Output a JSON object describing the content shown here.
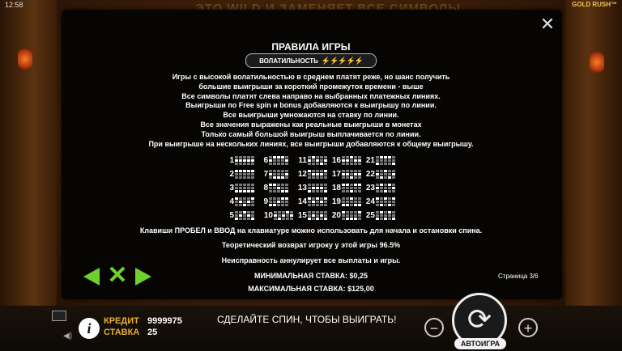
{
  "status": {
    "time": "12:58",
    "logo": "GOLD RUSH™"
  },
  "banner": "ЭТО WILD И ЗАМЕНЯЕТ ВСЕ СИМВОЛЫ",
  "rules_panel": {
    "title": "ПРАВИЛА ИГРЫ",
    "volatility_label": "ВОЛАТИЛЬНОСТЬ",
    "volatility_bolts": "⚡⚡⚡⚡⚡",
    "volatility_level": 5,
    "paragraphs": [
      "Игры с высокой волатильностью в среднем платят реже, но шанс получить",
      "большие выигрыши за короткий промежуток времени - выше",
      "Все символы платят слева направо на выбранных платежных линиях.",
      "Выигрыши по Free spin и bonus добавляются к выигрышу по линии.",
      "Все выигрыши умножаются на ставку по линии.",
      "Все значения выражены как реальные выигрыши в монетах",
      "Только самый большой выигрыш выплачивается по линии.",
      "При выигрыше на нескольких линиях, все выигрыши добавляются к общему выигрышу."
    ],
    "paylines": [
      {
        "n": "1",
        "p": [
          1,
          1,
          1,
          1,
          1
        ]
      },
      {
        "n": "2",
        "p": [
          0,
          0,
          0,
          0,
          0
        ]
      },
      {
        "n": "3",
        "p": [
          2,
          2,
          2,
          2,
          2
        ]
      },
      {
        "n": "4",
        "p": [
          0,
          1,
          2,
          1,
          0
        ]
      },
      {
        "n": "5",
        "p": [
          2,
          1,
          0,
          1,
          2
        ]
      },
      {
        "n": "6",
        "p": [
          1,
          0,
          0,
          0,
          1
        ]
      },
      {
        "n": "7",
        "p": [
          1,
          2,
          2,
          2,
          1
        ]
      },
      {
        "n": "8",
        "p": [
          0,
          0,
          1,
          2,
          2
        ]
      },
      {
        "n": "9",
        "p": [
          2,
          2,
          1,
          0,
          0
        ]
      },
      {
        "n": "10",
        "p": [
          1,
          2,
          1,
          0,
          1
        ]
      },
      {
        "n": "11",
        "p": [
          1,
          0,
          1,
          2,
          1
        ]
      },
      {
        "n": "12",
        "p": [
          0,
          1,
          1,
          1,
          0
        ]
      },
      {
        "n": "13",
        "p": [
          2,
          1,
          1,
          1,
          2
        ]
      },
      {
        "n": "14",
        "p": [
          0,
          1,
          0,
          1,
          0
        ]
      },
      {
        "n": "15",
        "p": [
          2,
          1,
          2,
          1,
          2
        ]
      },
      {
        "n": "16",
        "p": [
          1,
          1,
          0,
          1,
          1
        ]
      },
      {
        "n": "17",
        "p": [
          1,
          1,
          2,
          1,
          1
        ]
      },
      {
        "n": "18",
        "p": [
          0,
          0,
          2,
          0,
          0
        ]
      },
      {
        "n": "19",
        "p": [
          2,
          2,
          0,
          2,
          2
        ]
      },
      {
        "n": "20",
        "p": [
          0,
          2,
          2,
          2,
          0
        ]
      },
      {
        "n": "21",
        "p": [
          2,
          0,
          0,
          0,
          2
        ]
      },
      {
        "n": "22",
        "p": [
          1,
          2,
          0,
          2,
          1
        ]
      },
      {
        "n": "23",
        "p": [
          1,
          0,
          2,
          0,
          1
        ]
      },
      {
        "n": "24",
        "p": [
          0,
          2,
          0,
          2,
          0
        ]
      },
      {
        "n": "25",
        "p": [
          2,
          0,
          2,
          0,
          2
        ]
      }
    ],
    "keyboard_note": "Клавиши ПРОБЕЛ и ВВОД на клавиатуре можно использовать для начала и остановки спина.",
    "rtp": "Теоретический возврат игроку у этой игры  96.5%",
    "malfunction": "Неисправность аннулирует все выплаты и игры.",
    "min_bet": "МИНИМАЛЬНАЯ СТАВКА: $0,25",
    "max_bet": "МАКСИМАЛЬНАЯ СТАВКА: $125,00",
    "page": "Страница 3/6"
  },
  "bottom_bar": {
    "credit_label": "КРЕДИТ",
    "credit_value": "9999975",
    "bet_label": "СТАВКА",
    "bet_value": "25",
    "message": "СДЕЛАЙТЕ СПИН, ЧТОБЫ ВЫИГРАТЬ!",
    "autoplay_label": "АВТОИГРА"
  },
  "colors": {
    "accent_green": "#6ed12e",
    "label_gold": "#e8b12e",
    "bolt_yellow": "#f7c51e"
  }
}
